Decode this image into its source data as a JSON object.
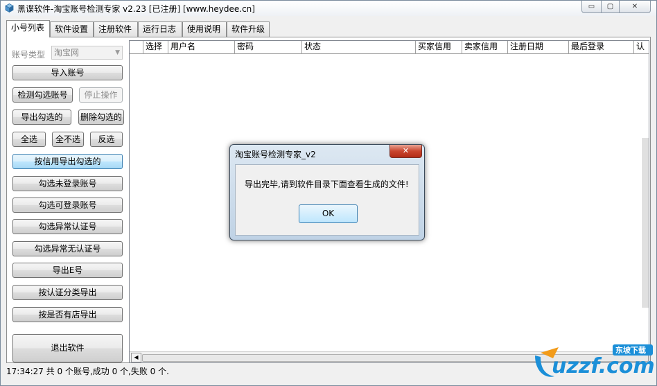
{
  "window": {
    "title": "黑谍软件-淘宝账号检测专家 v2.23 [已注册] [www.heydee.cn]",
    "min_glyph": "▭",
    "max_glyph": "▢",
    "close_glyph": "✕"
  },
  "tabs": [
    "小号列表",
    "软件设置",
    "注册软件",
    "运行日志",
    "使用说明",
    "软件升级"
  ],
  "left_panel": {
    "account_type_label": "账号类型",
    "account_type_value": "淘宝网",
    "buttons": {
      "import": "导入账号",
      "check_selected": "检测勾选账号",
      "stop": "停止操作",
      "export_selected": "导出勾选的",
      "delete_selected": "删除勾选的",
      "select_all": "全选",
      "select_none": "全不选",
      "invert": "反选",
      "export_by_credit": "按信用导出勾选的",
      "select_not_logged": "勾选未登录账号",
      "select_loggable": "勾选可登录账号",
      "select_abnormal_verified": "勾选异常认证号",
      "select_abnormal_unverified": "勾选异常无认证号",
      "export_e": "导出E号",
      "export_by_cert": "按认证分类导出",
      "export_by_shop": "按是否有店导出",
      "exit": "退出软件"
    }
  },
  "grid": {
    "columns": [
      "选择",
      "用户名",
      "密码",
      "状态",
      "买家信用",
      "卖家信用",
      "注册日期",
      "最后登录",
      "认"
    ]
  },
  "status_bar": "17:34:27 共 0 个账号,成功 0 个,失败 0 个.",
  "dialog": {
    "title": "淘宝账号检测专家_v2",
    "close_glyph": "✕",
    "message": "导出完毕,请到软件目录下面查看生成的文件!",
    "ok_label": "OK"
  },
  "watermark": {
    "text": "uzzf.com",
    "badge": "东坡下载"
  }
}
